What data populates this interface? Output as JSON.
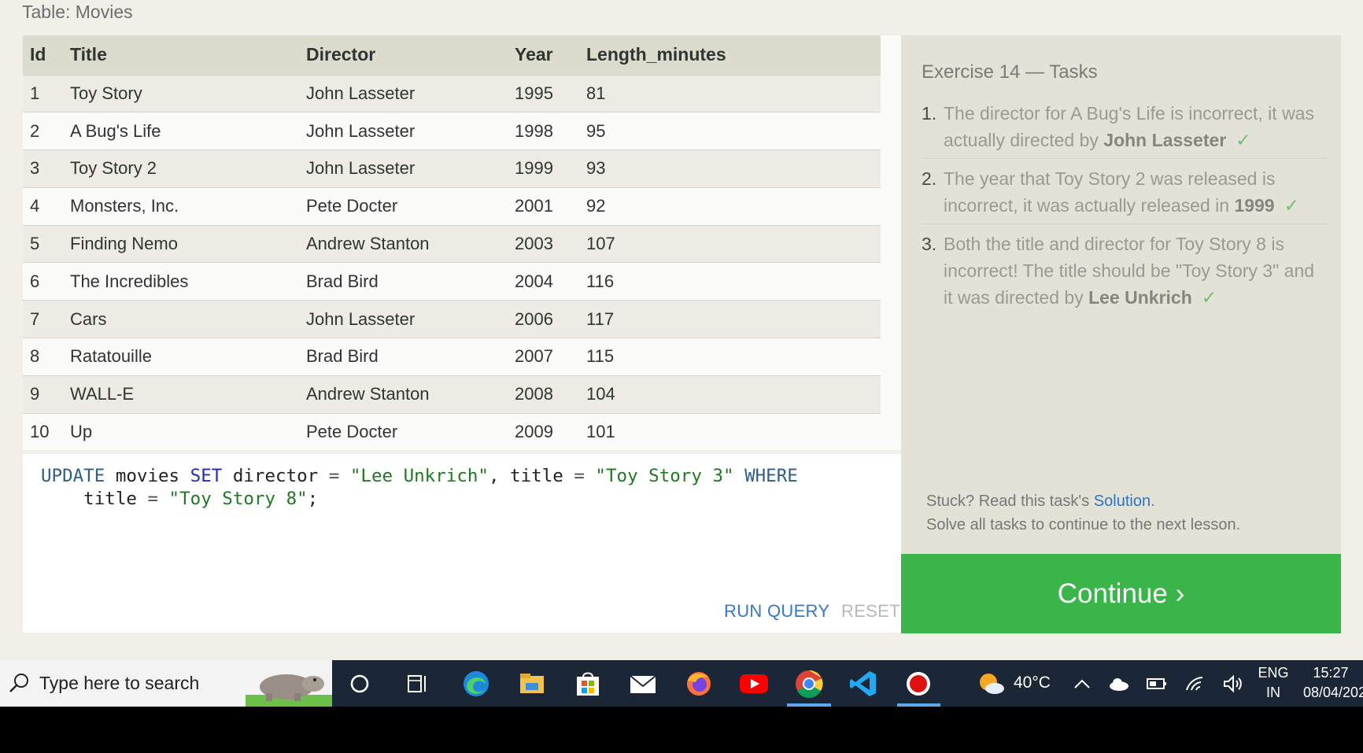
{
  "table_caption": "Table: Movies",
  "table": {
    "headers": [
      "Id",
      "Title",
      "Director",
      "Year",
      "Length_minutes"
    ],
    "rows": [
      [
        "1",
        "Toy Story",
        "John Lasseter",
        "1995",
        "81"
      ],
      [
        "2",
        "A Bug's Life",
        "John Lasseter",
        "1998",
        "95"
      ],
      [
        "3",
        "Toy Story 2",
        "John Lasseter",
        "1999",
        "93"
      ],
      [
        "4",
        "Monsters, Inc.",
        "Pete Docter",
        "2001",
        "92"
      ],
      [
        "5",
        "Finding Nemo",
        "Andrew Stanton",
        "2003",
        "107"
      ],
      [
        "6",
        "The Incredibles",
        "Brad Bird",
        "2004",
        "116"
      ],
      [
        "7",
        "Cars",
        "John Lasseter",
        "2006",
        "117"
      ],
      [
        "8",
        "Ratatouille",
        "Brad Bird",
        "2007",
        "115"
      ],
      [
        "9",
        "WALL-E",
        "Andrew Stanton",
        "2008",
        "104"
      ],
      [
        "10",
        "Up",
        "Pete Docter",
        "2009",
        "101"
      ]
    ]
  },
  "editor": {
    "query_line1": {
      "k1": "UPDATE",
      "t1": " movies ",
      "k2": "SET",
      "t2": " director ",
      "o1": "=",
      "s1": " \"Lee Unkrich\"",
      "t3": ", title ",
      "o2": "=",
      "s2": " \"Toy Story 3\"",
      "k3": " WHERE"
    },
    "query_line2": {
      "t1": "    title ",
      "o1": "=",
      "s1": " \"Toy Story 8\"",
      "t2": ";"
    },
    "run_label": "RUN QUERY",
    "reset_label": "RESET"
  },
  "tasks": {
    "title": "Exercise 14 — Tasks",
    "items": [
      {
        "num": "1.",
        "text": "The director for A Bug's Life is incorrect, it was actually directed by ",
        "bold": "John Lasseter",
        "check": "✓"
      },
      {
        "num": "2.",
        "text": "The year that Toy Story 2 was released is incorrect, it was actually released in ",
        "bold": "1999",
        "check": "✓"
      },
      {
        "num": "3.",
        "text": "Both the title and director for Toy Story 8 is incorrect! The title should be \"Toy Story 3\" and it was directed by ",
        "bold": "Lee Unkrich",
        "check": "✓"
      }
    ],
    "stuck_prefix": "Stuck? Read this task's ",
    "solution_link": "Solution",
    "stuck_suffix": ".",
    "next_lesson": "Solve all tasks to continue to the next lesson.",
    "continue_label": "Continue ›"
  },
  "taskbar": {
    "search_placeholder": "Type here to search",
    "temperature": "40°C",
    "lang_line1": "ENG",
    "lang_line2": "IN",
    "time": "15:27",
    "date": "08/04/202",
    "icons": [
      "cortana-icon",
      "task-view-icon",
      "edge-icon",
      "file-explorer-icon",
      "store-icon",
      "mail-icon",
      "firefox-icon",
      "youtube-icon",
      "chrome-icon",
      "vscode-icon",
      "recorder-icon"
    ]
  }
}
